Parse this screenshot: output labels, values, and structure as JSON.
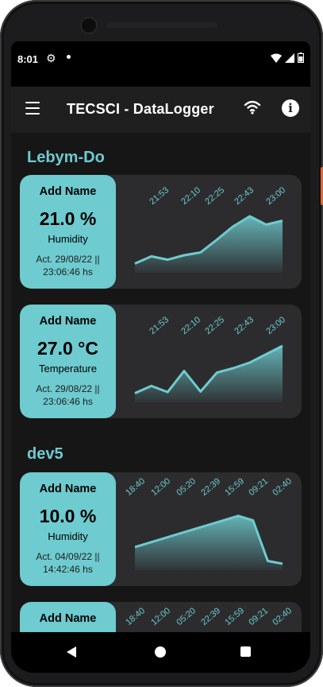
{
  "status_bar": {
    "time": "8:01",
    "icons": [
      "settings-icon",
      "dot-icon",
      "wifi-icon",
      "signal-icon",
      "battery-icon"
    ]
  },
  "app_bar": {
    "title": "TECSCI - DataLogger",
    "icons": [
      "menu-icon",
      "wifi-icon",
      "info-icon"
    ],
    "info_glyph": "i"
  },
  "colors": {
    "accent": "#6ecbcf",
    "card_bg": "#2c2c2e",
    "app_bar_bg": "#1f1f1f",
    "page_bg": "#161616"
  },
  "sections": [
    {
      "title": "Lebym-Do",
      "cards": [
        {
          "name": "Add Name",
          "value": "21.0 %",
          "type": "Humidity",
          "date_line1": "Act. 29/08/22 ||",
          "date_line2": "23:06:46 hs",
          "x_ticks": [
            "21:53",
            "22:10",
            "22:25",
            "22:43",
            "23:00"
          ],
          "series": [
            0.05,
            0.18,
            0.12,
            0.2,
            0.25,
            0.48,
            0.72,
            0.9,
            0.75,
            0.82
          ]
        },
        {
          "name": "Add Name",
          "value": "27.0 °C",
          "type": "Temperature",
          "date_line1": "Act. 29/08/22 ||",
          "date_line2": "23:06:46 hs",
          "x_ticks": [
            "21:53",
            "22:10",
            "22:25",
            "22:43",
            "23:00"
          ],
          "series": [
            0.05,
            0.18,
            0.07,
            0.45,
            0.08,
            0.42,
            0.5,
            0.6,
            0.75,
            0.9
          ]
        }
      ]
    },
    {
      "title": "dev5",
      "cards": [
        {
          "name": "Add Name",
          "value": "10.0 %",
          "type": "Humidity",
          "date_line1": "Act. 04/09/22 ||",
          "date_line2": "14:42:46 hs",
          "x_ticks": [
            "18:40",
            "12:00",
            "05:20",
            "22:39",
            "15:59",
            "09:21",
            "02:40"
          ],
          "series": [
            0.3,
            0.38,
            0.46,
            0.54,
            0.62,
            0.7,
            0.78,
            0.86,
            0.78,
            0.05,
            0.0
          ]
        },
        {
          "name": "Add Name",
          "x_ticks": [
            "18:40",
            "12:00",
            "05:20",
            "22:39",
            "15:59",
            "09:21",
            "02:40"
          ]
        }
      ]
    }
  ]
}
